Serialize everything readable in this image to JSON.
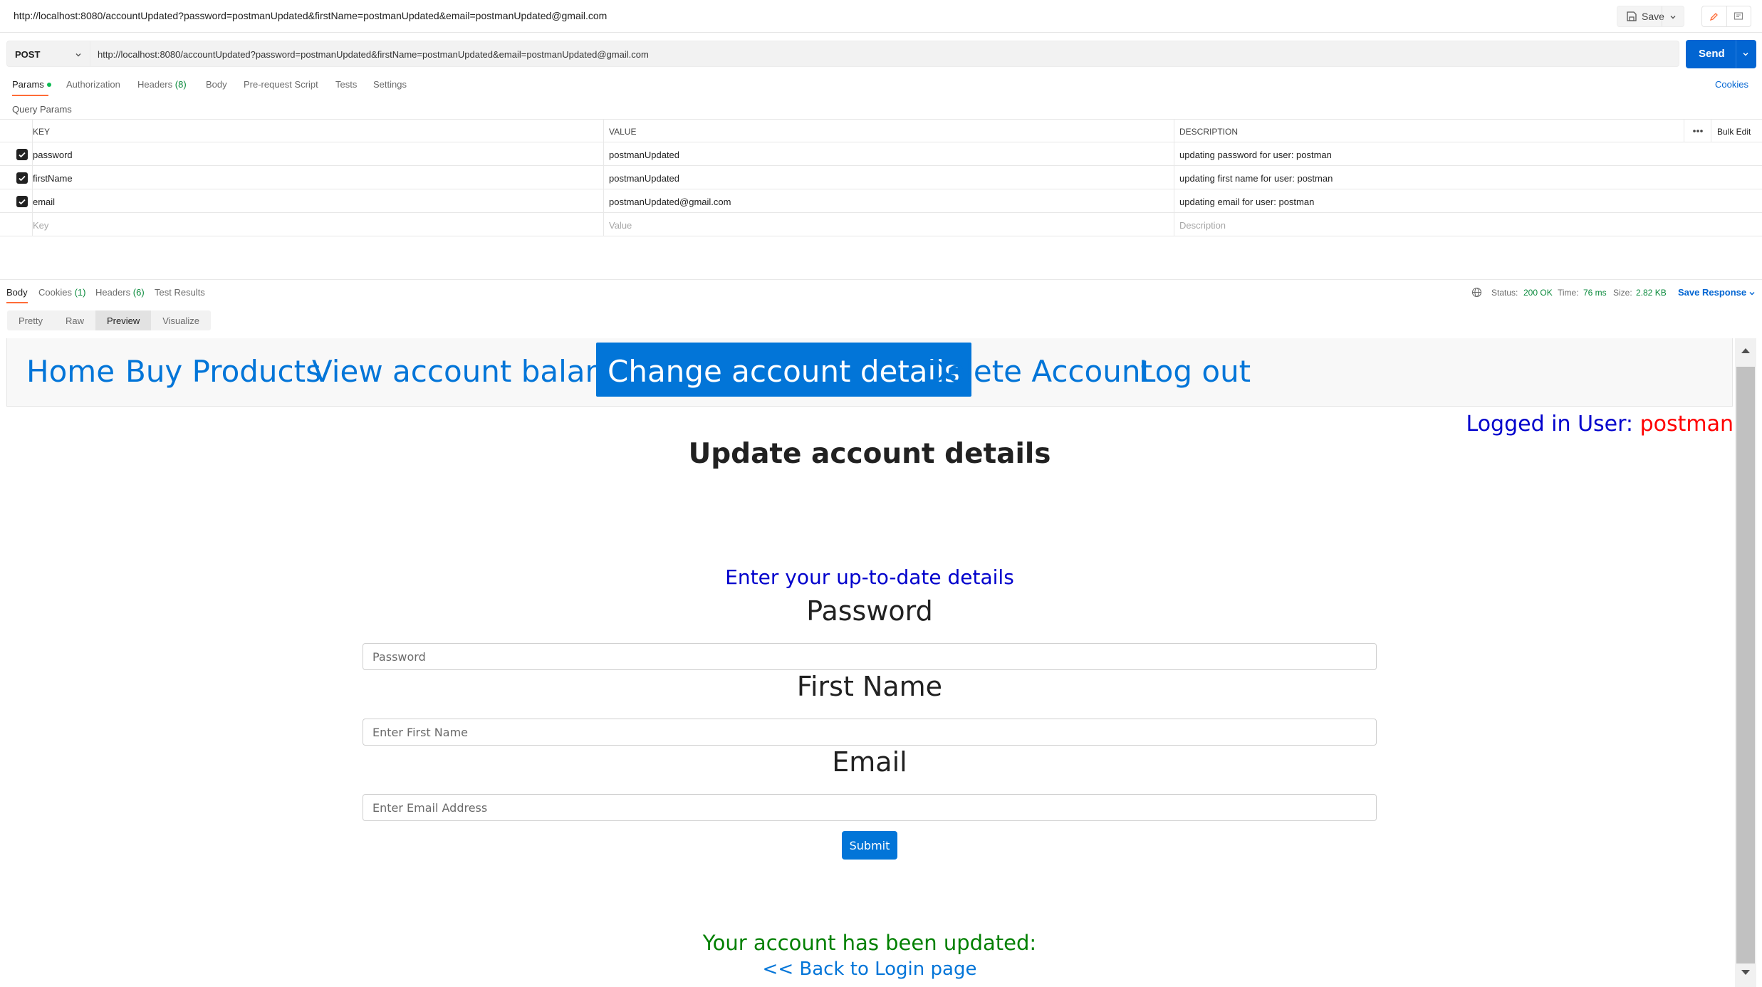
{
  "window": {
    "title": "http://localhost:8080/accountUpdated?password=postmanUpdated&firstName=postmanUpdated&email=postmanUpdated@gmail.com",
    "save_label": "Save"
  },
  "request": {
    "method": "POST",
    "url": "http://localhost:8080/accountUpdated?password=postmanUpdated&firstName=postmanUpdated&email=postmanUpdated@gmail.com",
    "send_label": "Send",
    "tabs": {
      "params": "Params",
      "authorization": "Authorization",
      "headers": "Headers",
      "headers_count": "(8)",
      "body": "Body",
      "prerequest": "Pre-request Script",
      "tests": "Tests",
      "settings": "Settings"
    },
    "cookies_label": "Cookies",
    "query_params_label": "Query Params"
  },
  "params_table": {
    "columns": [
      "KEY",
      "VALUE",
      "DESCRIPTION"
    ],
    "bulk_edit": "Bulk Edit",
    "rows": [
      {
        "key": "password",
        "value": "postmanUpdated",
        "description": "updating password for user: postman",
        "checked": true
      },
      {
        "key": "firstName",
        "value": "postmanUpdated",
        "description": "updating first name for user: postman",
        "checked": true
      },
      {
        "key": "email",
        "value": "postmanUpdated@gmail.com",
        "description": "updating email for user: postman",
        "checked": true
      }
    ],
    "placeholder": {
      "key": "Key",
      "value": "Value",
      "description": "Description"
    }
  },
  "response": {
    "tabs": {
      "body": "Body",
      "cookies": "Cookies",
      "cookies_count": "(1)",
      "headers": "Headers",
      "headers_count": "(6)",
      "test_results": "Test Results"
    },
    "status_label": "Status:",
    "status": "200 OK",
    "time_label": "Time:",
    "time": "76 ms",
    "size_label": "Size:",
    "size": "2.82 KB",
    "save_response": "Save Response",
    "view_modes": [
      "Pretty",
      "Raw",
      "Preview",
      "Visualize"
    ],
    "active_view": "Preview"
  },
  "preview": {
    "nav": [
      "Home",
      "Buy Products",
      "View account balance",
      "Change account details",
      "Delete Account",
      "Log out"
    ],
    "active_nav": "Change account details",
    "logged_in_label": "Logged in User:",
    "logged_in_user": "postman",
    "heading": "Update account details",
    "form_intro": "Enter your up-to-date details",
    "fields": [
      {
        "label": "Password",
        "placeholder": "Password"
      },
      {
        "label": "First Name",
        "placeholder": "Enter First Name"
      },
      {
        "label": "Email",
        "placeholder": "Enter Email Address"
      }
    ],
    "submit_label": "Submit",
    "success_message": "Your account has been updated:",
    "back_link": "<< Back to Login page"
  },
  "colors": {
    "accent_orange": "#ff6c37",
    "send_blue": "#0265d2",
    "link_blue": "#0275d8",
    "status_green": "#0a8a3c",
    "success_green": "#008000",
    "user_red": "#ff0000"
  }
}
